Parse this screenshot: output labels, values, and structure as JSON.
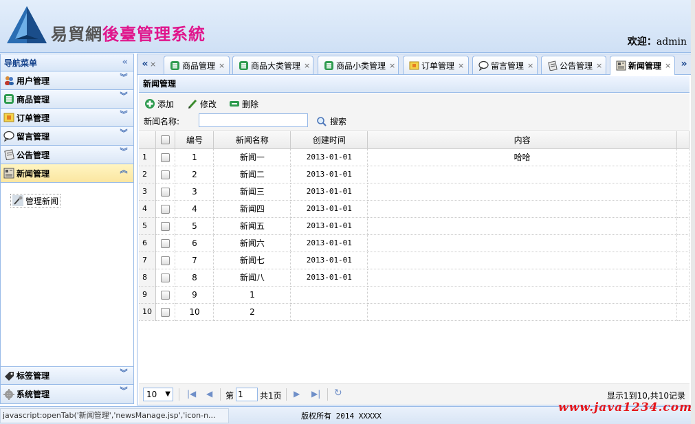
{
  "header": {
    "title_part1": "易貿網",
    "title_part2": "後臺管理系統",
    "welcome_label": "欢迎：",
    "username": "admin"
  },
  "sidebar": {
    "title": "导航菜单",
    "collapse_glyph": "«",
    "items": [
      {
        "label": "用户管理",
        "icon": "users-icon",
        "active": false
      },
      {
        "label": "商品管理",
        "icon": "list-icon",
        "active": false
      },
      {
        "label": "订单管理",
        "icon": "order-icon",
        "active": false
      },
      {
        "label": "留言管理",
        "icon": "speech-bubble-icon",
        "active": false
      },
      {
        "label": "公告管理",
        "icon": "notepad-icon",
        "active": false
      },
      {
        "label": "新闻管理",
        "icon": "newspaper-icon",
        "active": true
      }
    ],
    "sub_item": {
      "label": "管理新闻",
      "icon": "tools-icon"
    },
    "bottom_items": [
      {
        "label": "标签管理",
        "icon": "tag-icon"
      },
      {
        "label": "系统管理",
        "icon": "gear-icon"
      }
    ]
  },
  "tabs": {
    "scroll_left": "«",
    "scroll_right": "»",
    "items": [
      {
        "label": "商品管理",
        "icon": "list-icon",
        "active": false
      },
      {
        "label": "商品大类管理",
        "icon": "list-icon",
        "active": false
      },
      {
        "label": "商品小类管理",
        "icon": "list-icon",
        "active": false
      },
      {
        "label": "订单管理",
        "icon": "order-icon",
        "active": false
      },
      {
        "label": "留言管理",
        "icon": "speech-bubble-icon",
        "active": false
      },
      {
        "label": "公告管理",
        "icon": "notepad-icon",
        "active": false
      },
      {
        "label": "新闻管理",
        "icon": "newspaper-icon",
        "active": true
      }
    ],
    "close_glyph": "×"
  },
  "panel": {
    "title": "新闻管理",
    "toolbar": {
      "add_label": "添加",
      "edit_label": "修改",
      "delete_label": "删除"
    },
    "search": {
      "label": "新闻名称:",
      "value": "",
      "placeholder": "",
      "button_label": "搜索"
    }
  },
  "grid": {
    "columns": [
      "编号",
      "新闻名称",
      "创建时间",
      "内容"
    ],
    "rows": [
      {
        "num": "1",
        "id": "1",
        "name": "新闻一",
        "date": "2013-01-01",
        "content": "哈哈"
      },
      {
        "num": "2",
        "id": "2",
        "name": "新闻二",
        "date": "2013-01-01",
        "content": ""
      },
      {
        "num": "3",
        "id": "3",
        "name": "新闻三",
        "date": "2013-01-01",
        "content": ""
      },
      {
        "num": "4",
        "id": "4",
        "name": "新闻四",
        "date": "2013-01-01",
        "content": ""
      },
      {
        "num": "5",
        "id": "5",
        "name": "新闻五",
        "date": "2013-01-01",
        "content": ""
      },
      {
        "num": "6",
        "id": "6",
        "name": "新闻六",
        "date": "2013-01-01",
        "content": ""
      },
      {
        "num": "7",
        "id": "7",
        "name": "新闻七",
        "date": "2013-01-01",
        "content": ""
      },
      {
        "num": "8",
        "id": "8",
        "name": "新闻八",
        "date": "2013-01-01",
        "content": ""
      },
      {
        "num": "9",
        "id": "9",
        "name": "1",
        "date": "",
        "content": ""
      },
      {
        "num": "10",
        "id": "10",
        "name": "2",
        "date": "",
        "content": ""
      }
    ]
  },
  "pager": {
    "page_size": "10",
    "page_label_before": "第",
    "page_value": "1",
    "page_label_after": "共1页",
    "info": "显示1到10,共10记录"
  },
  "status": {
    "url": "javascript:openTab('新闻管理','newsManage.jsp','icon-n...",
    "copyright": "版权所有 2014 XXXXX",
    "watermark": "www.java1234.com"
  }
}
